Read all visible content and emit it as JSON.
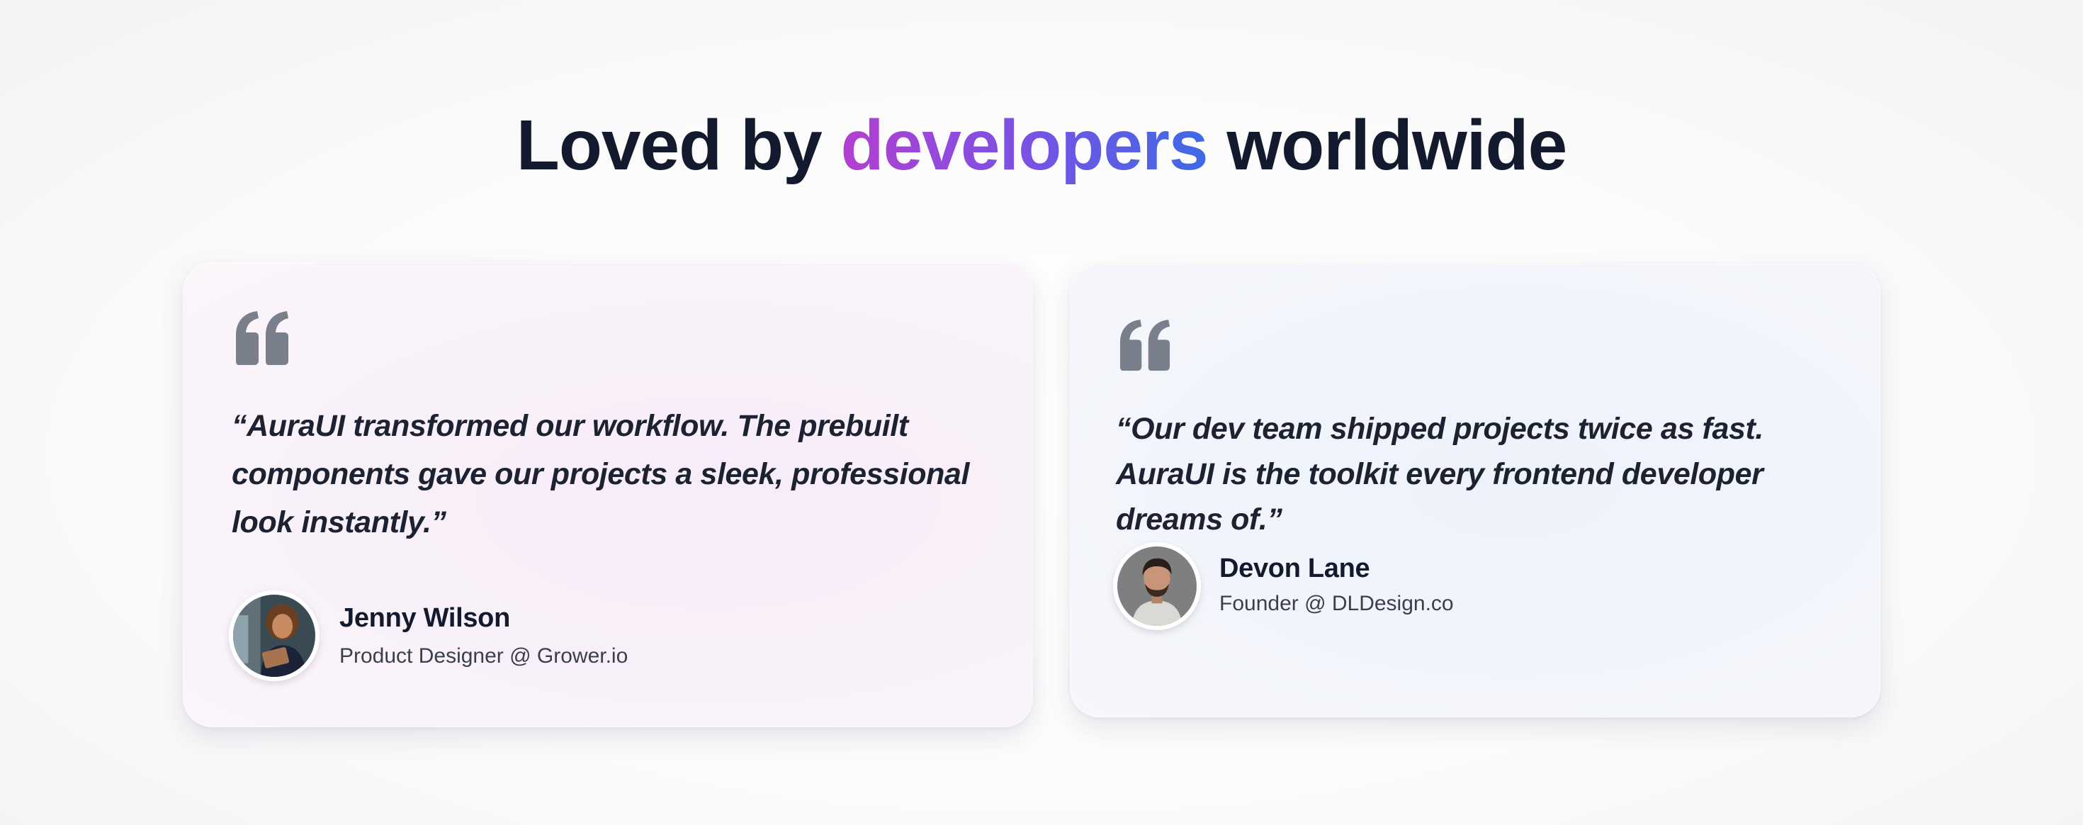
{
  "section": {
    "heading_start": "Loved by",
    "heading_accent": "developers",
    "heading_end": "worldwide",
    "accent_gradient": [
      "#b33fd0",
      "#7a52e4",
      "#3d6ae6"
    ]
  },
  "testimonials": [
    {
      "quote": "“AuraUI transformed our workflow. The prebuilt components gave our projects a sleek, professional look instantly.”",
      "name": "Jenny Wilson",
      "role": "Product Designer @ Grower.io",
      "avatar_icon": "avatar-photo-woman-with-tablet"
    },
    {
      "quote": "“Our dev team shipped projects twice as fast. AuraUI is the toolkit every frontend developer dreams of.”",
      "name": "Devon Lane",
      "role": "Founder @ DLDesign.co",
      "avatar_icon": "avatar-photo-bearded-man"
    }
  ],
  "colors": {
    "heading": "#141a2e",
    "quote_icon": "#7a7f8c",
    "body_text": "#1d2233",
    "muted_text": "#3a3f4e"
  }
}
